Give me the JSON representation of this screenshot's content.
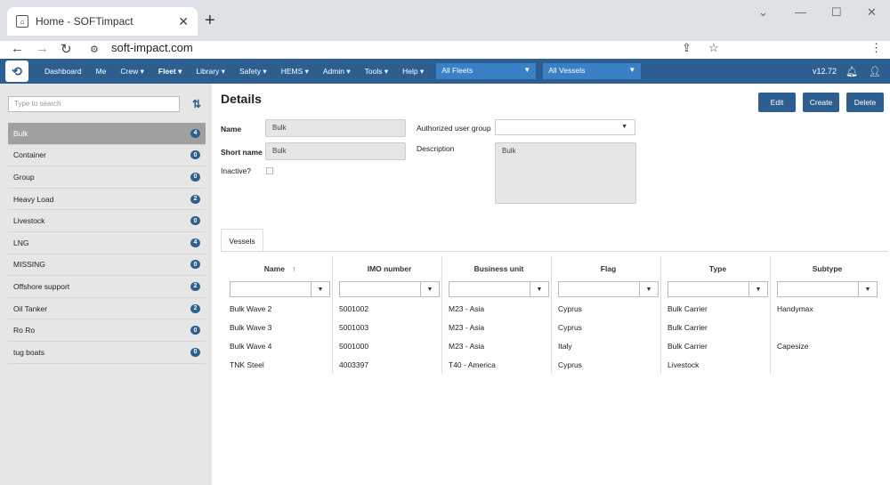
{
  "browser": {
    "tab_title": "Home - SOFTimpact",
    "url": "soft-impact.com"
  },
  "nav": {
    "items": [
      "Dashboard",
      "Me",
      "Crew ▾",
      "Fleet ▾",
      "Library ▾",
      "Safety ▾",
      "HEMS ▾",
      "Admin ▾",
      "Tools ▾",
      "Help ▾"
    ],
    "fleet_select": "All Fleets",
    "vessel_select": "All Vessels",
    "version": "v12.72"
  },
  "sidebar": {
    "search_placeholder": "Type to search",
    "items": [
      {
        "label": "Bulk",
        "count": "4",
        "selected": true
      },
      {
        "label": "Container",
        "count": "0"
      },
      {
        "label": "Group",
        "count": "0"
      },
      {
        "label": "Heavy Load",
        "count": "2"
      },
      {
        "label": "Livestock",
        "count": "0"
      },
      {
        "label": "LNG",
        "count": "4"
      },
      {
        "label": "MISSING",
        "count": "0"
      },
      {
        "label": "Offshore support",
        "count": "2"
      },
      {
        "label": "Oil Tanker",
        "count": "2"
      },
      {
        "label": "Ro Ro",
        "count": "0"
      },
      {
        "label": "tug boats",
        "count": "0"
      }
    ]
  },
  "details": {
    "title": "Details",
    "buttons": {
      "edit": "Edit",
      "create": "Create",
      "delete": "Delete"
    },
    "name_label": "Name",
    "name_value": "Bulk",
    "short_name_label": "Short name",
    "short_name_value": "Bulk",
    "inactive_label": "Inactive?",
    "auth_group_label": "Authorized user group",
    "auth_group_value": "",
    "description_label": "Description",
    "description_value": "Bulk"
  },
  "vessels_tab": {
    "tab_label": "Vessels",
    "columns": [
      "Name",
      "IMO number",
      "Business unit",
      "Flag",
      "Type",
      "Subtype"
    ],
    "sort_indicator": "↑",
    "rows": [
      [
        "Bulk Wave 2",
        "5001002",
        "M23 - Asia",
        "Cyprus",
        "Bulk Carrier",
        "Handymax"
      ],
      [
        "Bulk Wave 3",
        "5001003",
        "M23 - Asia",
        "Cyprus",
        "Bulk Carrier",
        ""
      ],
      [
        "Bulk Wave 4",
        "5001000",
        "M23 - Asia",
        "Italy",
        "Bulk Carrier",
        "Capesize"
      ],
      [
        "TNK Steel",
        "4003397",
        "T40 - America",
        "Cyprus",
        "Livestock",
        ""
      ]
    ]
  }
}
